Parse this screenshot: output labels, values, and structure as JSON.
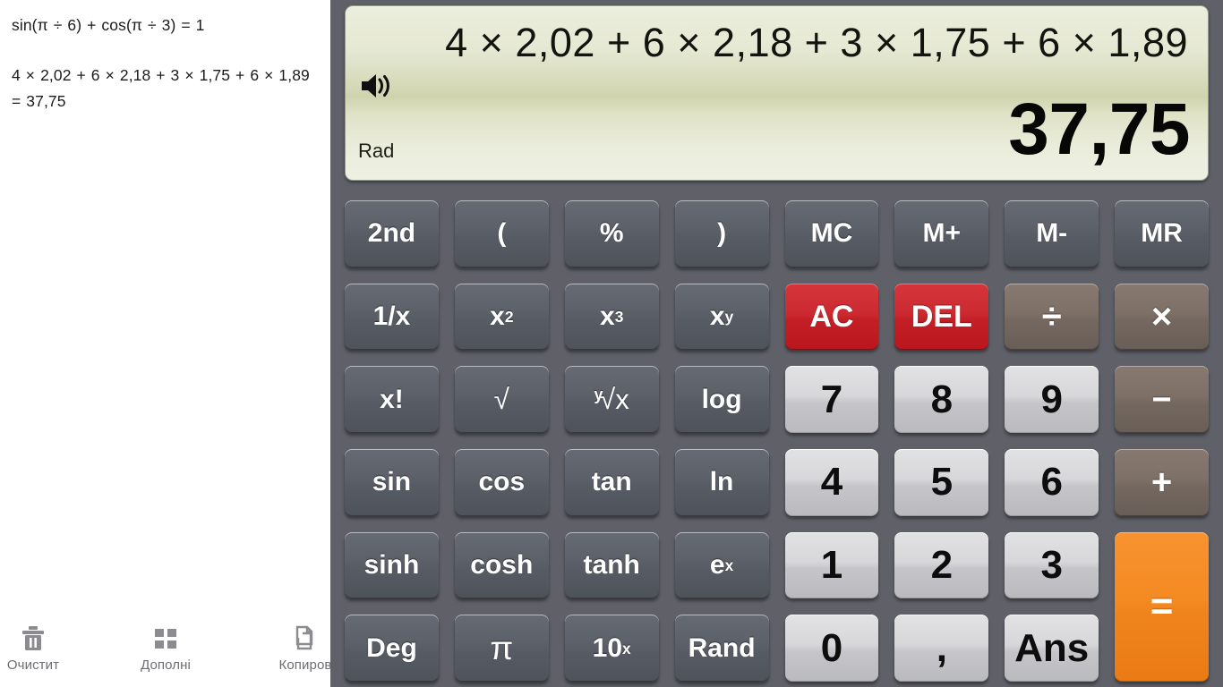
{
  "history": {
    "entries": [
      "sin(π ÷ 6) + cos(π ÷ 3) = 1",
      "4 × 2,02 + 6 × 2,18 + 3 × 1,75 + 6 × 1,89 = 37,75"
    ]
  },
  "toolbar": {
    "clear_label": "Очистит",
    "more_label": "Дополні",
    "copy_label": "Копиров",
    "clear_icon": "trash-icon",
    "more_icon": "grid-icon",
    "copy_icon": "copy-icon"
  },
  "display": {
    "expression": "4 × 2,02 + 6 × 2,18 + 3 × 1,75 + 6 × 1,89",
    "result": "37,75",
    "angle_mode": "Rad",
    "speaker_icon": "speaker-on-icon"
  },
  "keypad": {
    "rows": [
      [
        {
          "label": "2nd",
          "name": "key-2nd",
          "style": "fn"
        },
        {
          "label": "(",
          "name": "key-open-paren",
          "style": "fn"
        },
        {
          "label": "%",
          "name": "key-percent",
          "style": "fn"
        },
        {
          "label": ")",
          "name": "key-close-paren",
          "style": "fn"
        },
        {
          "label": "MC",
          "name": "key-mc",
          "style": "fn"
        },
        {
          "label": "M+",
          "name": "key-m-plus",
          "style": "fn"
        },
        {
          "label": "M-",
          "name": "key-m-minus",
          "style": "fn"
        },
        {
          "label": "MR",
          "name": "key-mr",
          "style": "fn"
        }
      ],
      [
        {
          "label": "1/x",
          "name": "key-reciprocal",
          "style": "fn"
        },
        {
          "base": "x",
          "sup": "2",
          "label": "x²",
          "name": "key-square",
          "style": "fn"
        },
        {
          "base": "x",
          "sup": "3",
          "label": "x³",
          "name": "key-cube",
          "style": "fn"
        },
        {
          "base": "x",
          "sup": "y",
          "label": "xʸ",
          "name": "key-power",
          "style": "fn"
        },
        {
          "label": "AC",
          "name": "key-ac",
          "style": "danger"
        },
        {
          "label": "DEL",
          "name": "key-del",
          "style": "danger"
        },
        {
          "label": "÷",
          "name": "key-divide",
          "style": "op"
        },
        {
          "label": "×",
          "name": "key-multiply",
          "style": "op"
        }
      ],
      [
        {
          "label": "x!",
          "name": "key-factorial",
          "style": "fn"
        },
        {
          "label": "√",
          "name": "key-sqrt",
          "style": "fn",
          "glyph": "sqrt"
        },
        {
          "ypre": "y",
          "label": "ⁿ√x",
          "base2": "√x",
          "name": "key-nth-root",
          "style": "fn",
          "glyph": "nthroot"
        },
        {
          "label": "log",
          "name": "key-log",
          "style": "fn"
        },
        {
          "label": "7",
          "name": "key-7",
          "style": "num"
        },
        {
          "label": "8",
          "name": "key-8",
          "style": "num"
        },
        {
          "label": "9",
          "name": "key-9",
          "style": "num"
        },
        {
          "label": "−",
          "name": "key-subtract",
          "style": "op",
          "glyph": "minus"
        }
      ],
      [
        {
          "label": "sin",
          "name": "key-sin",
          "style": "fn"
        },
        {
          "label": "cos",
          "name": "key-cos",
          "style": "fn"
        },
        {
          "label": "tan",
          "name": "key-tan",
          "style": "fn"
        },
        {
          "label": "ln",
          "name": "key-ln",
          "style": "fn"
        },
        {
          "label": "4",
          "name": "key-4",
          "style": "num"
        },
        {
          "label": "5",
          "name": "key-5",
          "style": "num"
        },
        {
          "label": "6",
          "name": "key-6",
          "style": "num"
        },
        {
          "label": "+",
          "name": "key-add",
          "style": "op"
        }
      ],
      [
        {
          "label": "sinh",
          "name": "key-sinh",
          "style": "fn"
        },
        {
          "label": "cosh",
          "name": "key-cosh",
          "style": "fn"
        },
        {
          "label": "tanh",
          "name": "key-tanh",
          "style": "fn"
        },
        {
          "base": "e",
          "sup": "x",
          "label": "eˣ",
          "name": "key-exp",
          "style": "fn"
        },
        {
          "label": "1",
          "name": "key-1",
          "style": "num"
        },
        {
          "label": "2",
          "name": "key-2",
          "style": "num"
        },
        {
          "label": "3",
          "name": "key-3",
          "style": "num"
        },
        {
          "label": "=",
          "name": "key-equals",
          "style": "equals"
        }
      ],
      [
        {
          "label": "Deg",
          "name": "key-deg",
          "style": "fn"
        },
        {
          "label": "π",
          "name": "key-pi",
          "style": "fn",
          "glyph": "pi"
        },
        {
          "base": "10",
          "sup": "x",
          "label": "10ˣ",
          "name": "key-power-ten",
          "style": "fn"
        },
        {
          "label": "Rand",
          "name": "key-rand",
          "style": "fn"
        },
        {
          "label": "0",
          "name": "key-0",
          "style": "num"
        },
        {
          "label": ",",
          "name": "key-decimal-comma",
          "style": "num"
        },
        {
          "label": "Ans",
          "name": "key-ans",
          "style": "num"
        }
      ]
    ]
  },
  "colors": {
    "panel_bg": "#5f6068",
    "history_bg": "#ffffff",
    "display_bg": "#e5e8d2",
    "fn_key": "#5d626a",
    "num_key": "#d0d0d4",
    "danger_key": "#c8242c",
    "op_key": "#7a6e65",
    "equals_key": "#f2851c",
    "toolbar_text": "#6d6d72"
  }
}
